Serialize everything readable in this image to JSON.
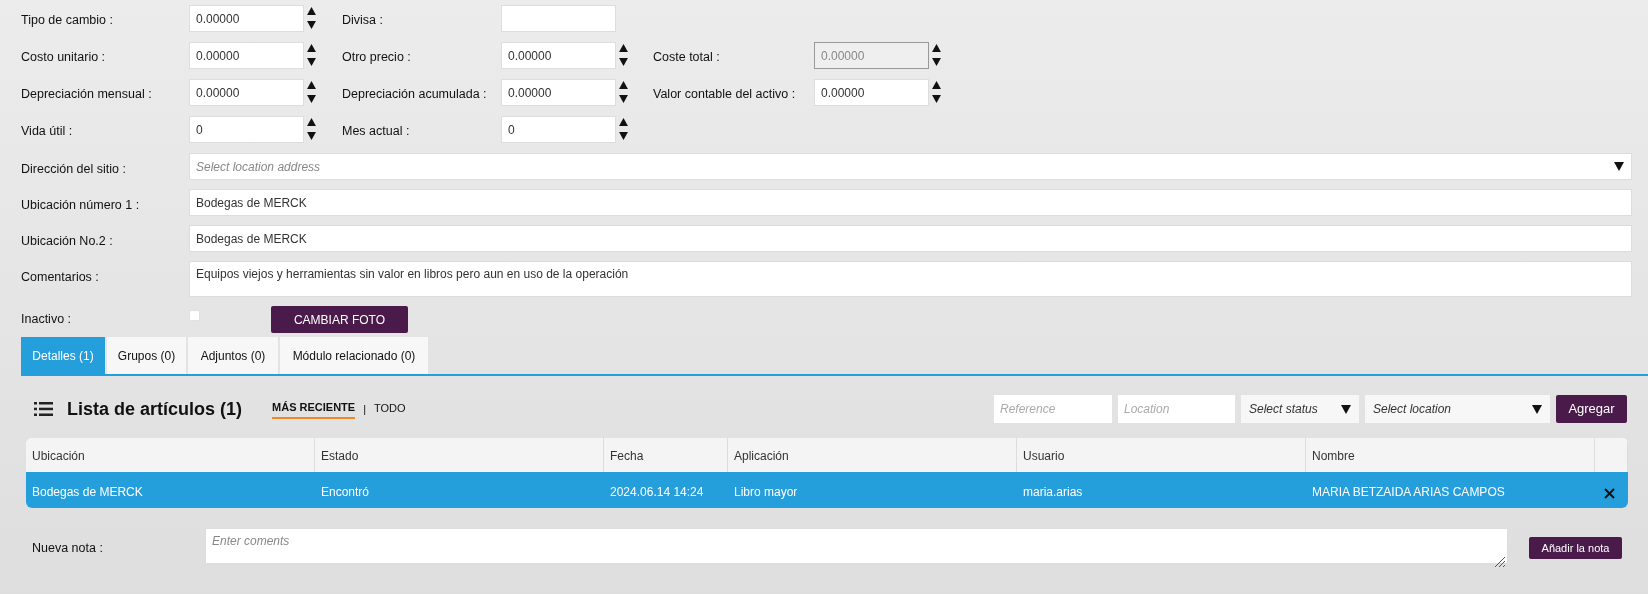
{
  "numeric_rows": [
    [
      {
        "label": "Tipo de cambio :",
        "kind": "spin",
        "value": "0.00000"
      },
      {
        "label": "Divisa :",
        "kind": "text"
      }
    ],
    [
      {
        "label": "Costo unitario :",
        "kind": "spin",
        "value": "0.00000"
      },
      {
        "label": "Otro precio :",
        "kind": "spin",
        "value": "0.00000"
      },
      {
        "label": "Coste total :",
        "kind": "spin",
        "value": "0.00000",
        "disabled": true
      }
    ],
    [
      {
        "label": "Depreciación mensual :",
        "kind": "spin",
        "value": "0.00000"
      },
      {
        "label": "Depreciación acumulada :",
        "kind": "spin",
        "value": "0.00000"
      },
      {
        "label": "Valor contable del activo :",
        "kind": "spin",
        "value": "0.00000"
      }
    ],
    [
      {
        "label": "Vida útil :",
        "kind": "spin",
        "value": "0"
      },
      {
        "label": "Mes actual :",
        "kind": "spin",
        "value": "0"
      }
    ]
  ],
  "wide_rows": [
    {
      "label": "Dirección del sitio :",
      "kind": "select",
      "placeholder": "Select location address"
    },
    {
      "label": "Ubicación número 1 :",
      "kind": "text",
      "value": "Bodegas de MERCK"
    },
    {
      "label": "Ubicación No.2 :",
      "kind": "text",
      "value": "Bodegas de MERCK"
    },
    {
      "label": "Comentarios :",
      "kind": "textarea",
      "value": "Equipos viejos y herramientas sin valor en libros pero aun en uso de la operación"
    }
  ],
  "inactive": {
    "label": "Inactivo :",
    "checked": false
  },
  "photo_button": "CAMBIAR FOTO",
  "tabs": [
    {
      "label": "Detalles (1)",
      "selected": true
    },
    {
      "label": "Grupos (0)",
      "selected": false
    },
    {
      "label": "Adjuntos (0)",
      "selected": false
    },
    {
      "label": "Módulo relacionado (0)",
      "selected": false
    }
  ],
  "list": {
    "title": "Lista de artículos (1)",
    "views": [
      {
        "label": "MÁS RECIENTE",
        "selected": true
      },
      {
        "label": "TODO",
        "selected": false
      }
    ],
    "view_separator": "|",
    "filters": [
      {
        "kind": "text",
        "placeholder": "Reference"
      },
      {
        "kind": "text",
        "placeholder": "Location"
      },
      {
        "kind": "select",
        "placeholder": "Select status"
      },
      {
        "kind": "select",
        "placeholder": "Select location"
      }
    ],
    "add_button": "Agregar"
  },
  "table": {
    "columns": [
      "Ubicación",
      "Estado",
      "Fecha",
      "Aplicación",
      "Usuario",
      "Nombre"
    ],
    "rows": [
      {
        "cells": [
          "Bodegas de MERCK",
          "Encontró",
          "2024.06.14 14:24",
          "Libro mayor",
          "maria.arias",
          "MARIA BETZAIDA ARIAS CAMPOS"
        ],
        "selected": true
      }
    ]
  },
  "note": {
    "label": "Nueva nota :",
    "placeholder": "Enter coments",
    "button": "Añadir la nota"
  }
}
